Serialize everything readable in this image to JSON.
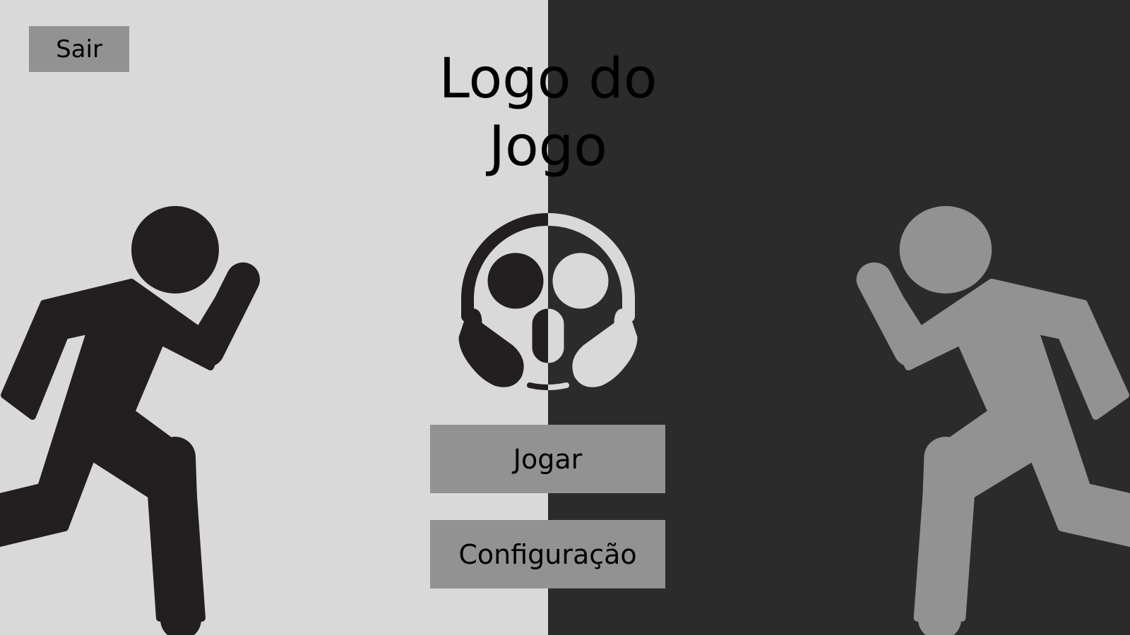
{
  "exit_button": {
    "label": "Sair"
  },
  "logo": {
    "line1": "Logo do",
    "line2": "Jogo"
  },
  "menu": {
    "play_label": "Jogar",
    "settings_label": "Configuração"
  },
  "icons": {
    "left_figure": "running-person-icon",
    "right_figure": "running-person-icon",
    "center": "screaming-face-icon"
  },
  "colors": {
    "left_background": "#d9d9d9",
    "right_background": "#2b2b2b",
    "button": "#929292",
    "dark_figure": "#231f20",
    "light_figure": "#929292"
  }
}
